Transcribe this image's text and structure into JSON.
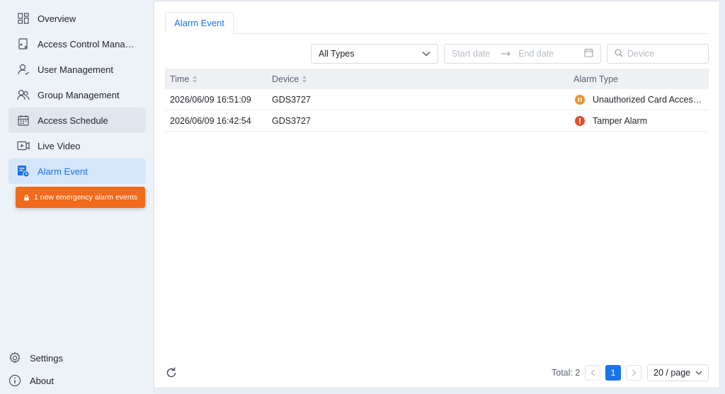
{
  "sidebar": {
    "items": [
      {
        "label": "Overview",
        "icon": "grid-icon"
      },
      {
        "label": "Access Control Manag...",
        "icon": "door-icon"
      },
      {
        "label": "User Management",
        "icon": "user-icon"
      },
      {
        "label": "Group Management",
        "icon": "group-icon"
      },
      {
        "label": "Access Schedule",
        "icon": "calendar-icon"
      },
      {
        "label": "Live Video",
        "icon": "video-icon"
      },
      {
        "label": "Alarm Event",
        "icon": "alarm-list-icon"
      }
    ],
    "toast": "1 new emergency alarm events",
    "settings_label": "Settings",
    "about_label": "About"
  },
  "main": {
    "tab_label": "Alarm Event",
    "filters": {
      "type_selected": "All Types",
      "start_date_placeholder": "Start date",
      "end_date_placeholder": "End date",
      "device_placeholder": "Device"
    },
    "table": {
      "headers": {
        "time": "Time",
        "device": "Device",
        "alarm_type": "Alarm Type"
      },
      "rows": [
        {
          "time": "2026/06/09 16:51:09",
          "device": "GDS3727",
          "alarm_type": "Unauthorized Card Access ...",
          "alarm_icon": "pause-badge-icon",
          "alarm_color": "#f0922b"
        },
        {
          "time": "2026/06/09 16:42:54",
          "device": "GDS3727",
          "alarm_type": "Tamper Alarm",
          "alarm_icon": "exclamation-badge-icon",
          "alarm_color": "#e54b2c"
        }
      ]
    },
    "pagination": {
      "total_label": "Total: 2",
      "current_page": "1",
      "page_size": "20 / page"
    }
  },
  "colors": {
    "accent": "#1a73e8",
    "toast": "#f26b1d",
    "active_nav_bg": "#d4e6fb"
  }
}
